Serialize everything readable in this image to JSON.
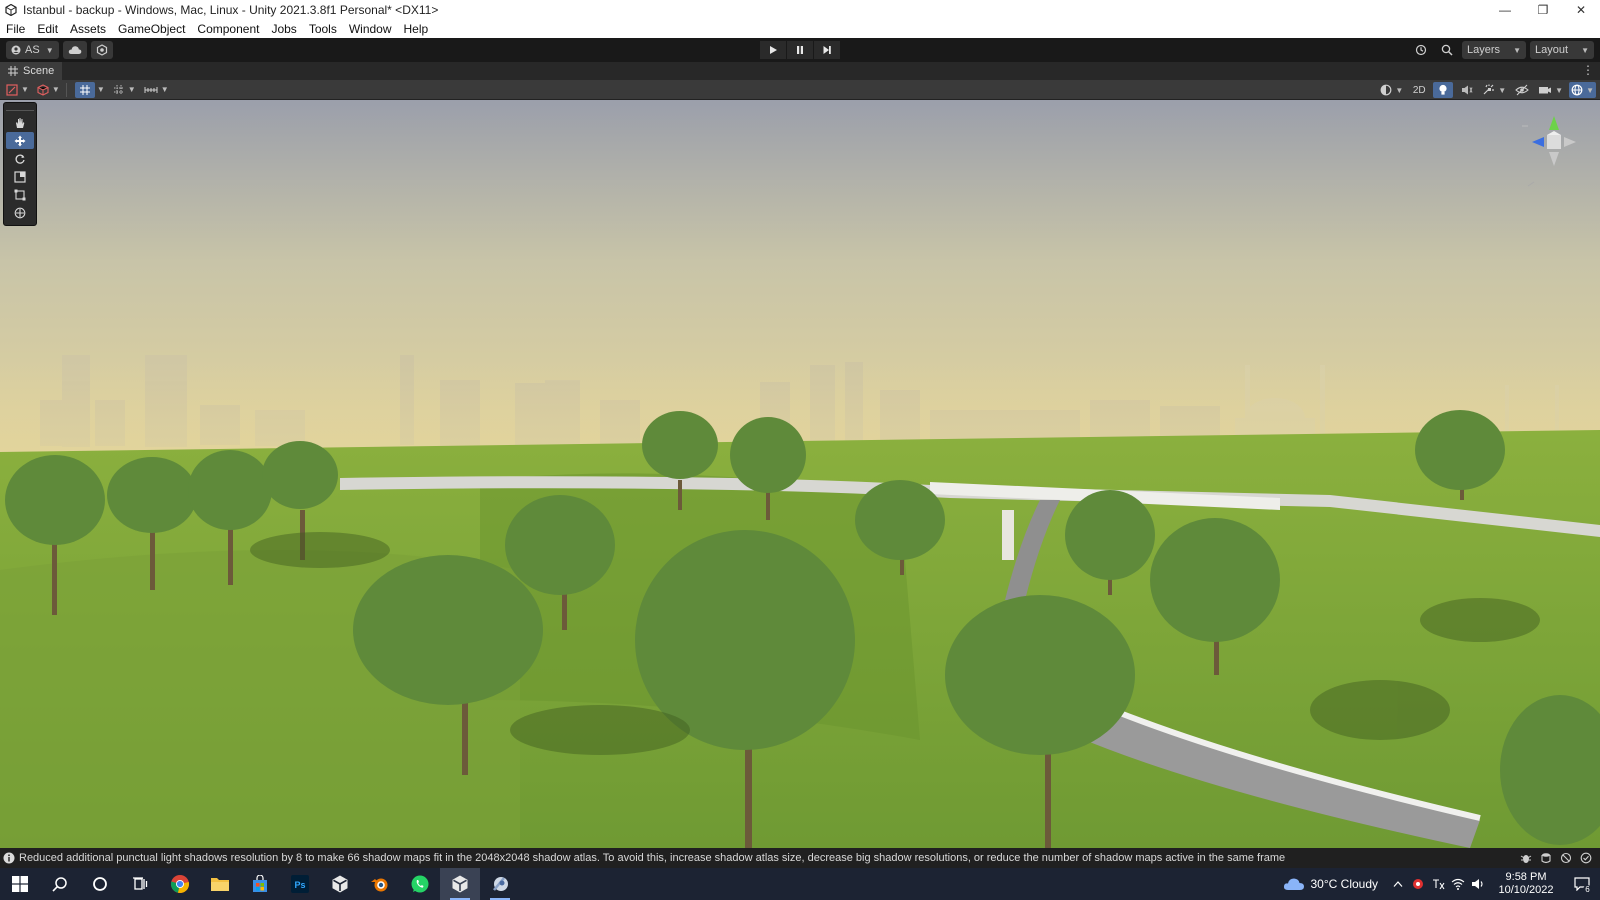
{
  "window": {
    "title": "Istanbul - backup - Windows, Mac, Linux - Unity 2021.3.8f1 Personal* <DX11>",
    "minimize_glyph": "—",
    "maximize_glyph": "❐",
    "close_glyph": "✕"
  },
  "menu": [
    "File",
    "Edit",
    "Assets",
    "GameObject",
    "Component",
    "Jobs",
    "Tools",
    "Window",
    "Help"
  ],
  "toolbar": {
    "account_label": "AS",
    "layers_label": "Layers",
    "layout_label": "Layout"
  },
  "scene_tab": {
    "label": "Scene",
    "menu_glyph": "⋮"
  },
  "scene_toolbar": {
    "mode_2d_label": "2D"
  },
  "status": {
    "message": "Reduced additional punctual light shadows resolution by 8 to make 66 shadow maps fit in the 2048x2048 shadow atlas. To avoid this, increase shadow atlas size, decrease big shadow resolutions, or reduce the number of shadow maps active in the same frame"
  },
  "taskbar": {
    "photoshop_label": "Ps",
    "weather": "30°C  Cloudy",
    "time": "9:58 PM",
    "date": "10/10/2022",
    "notification_count": "6"
  },
  "colors": {
    "sky_top": "#9b9fab",
    "sky_horizon": "#e2d49c",
    "grass": "#7ea33a",
    "grass_dark": "#5e8a2c",
    "tree": "#5f8a3a",
    "accent_blue": "#4a6a9a",
    "taskbar": "#1c2333"
  }
}
